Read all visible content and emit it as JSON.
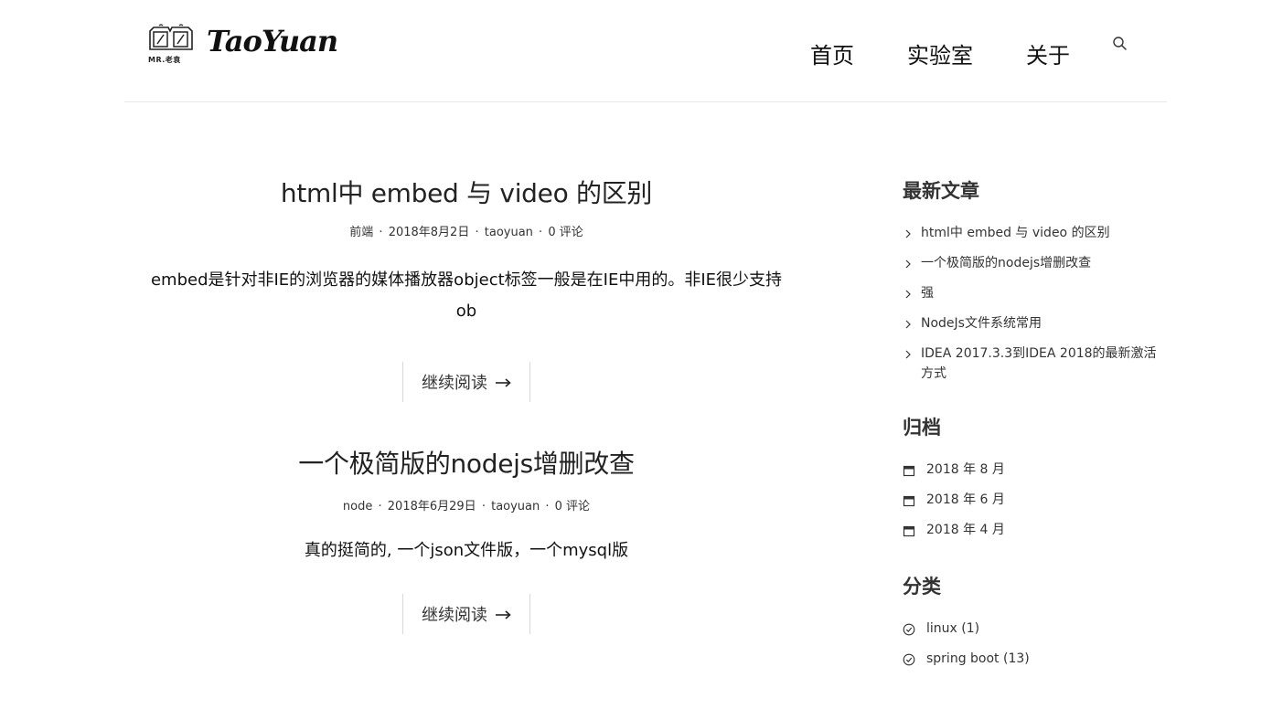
{
  "header": {
    "logo_caption": "MR.老袁",
    "logo_text": "TaoYuan",
    "nav": [
      "首页",
      "实验室",
      "关于"
    ],
    "search_icon": "search-icon"
  },
  "posts": [
    {
      "title": "html中 embed 与 video 的区别",
      "category": "前端",
      "date": "2018年8月2日",
      "author": "taoyuan",
      "comments": "0 评论",
      "excerpt": "embed是针对非IE的浏览器的媒体播放器object标签一般是在IE中用的。非IE很少支持ob",
      "read_more": "继续阅读"
    },
    {
      "title": "一个极简版的nodejs增删改查",
      "category": "node",
      "date": "2018年6月29日",
      "author": "taoyuan",
      "comments": "0 评论",
      "excerpt": "真的挺简的, 一个json文件版，一个mysql版",
      "read_more": "继续阅读"
    }
  ],
  "sidebar": {
    "recent": {
      "title": "最新文章",
      "items": [
        "html中 embed 与 video 的区别",
        "一个极简版的nodejs增删改查",
        "强",
        "NodeJs文件系统常用",
        "IDEA 2017.3.3到IDEA 2018的最新激活方式"
      ]
    },
    "archive": {
      "title": "归档",
      "items": [
        "2018 年 8 月",
        "2018 年 6 月",
        "2018 年 4 月"
      ]
    },
    "categories": {
      "title": "分类",
      "items": [
        "linux (1)",
        "spring boot (13)"
      ]
    }
  }
}
